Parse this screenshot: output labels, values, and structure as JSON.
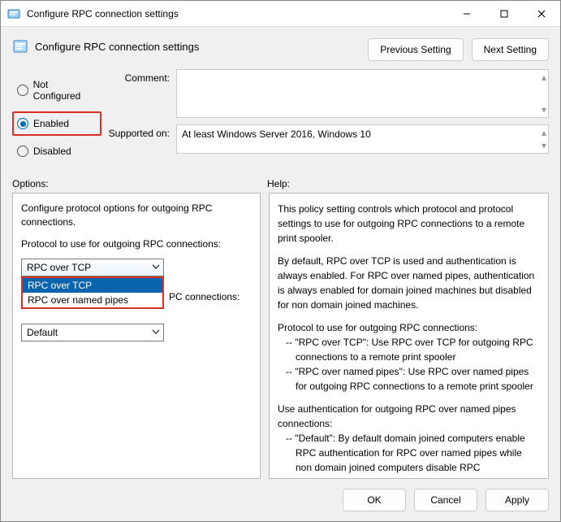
{
  "window": {
    "title": "Configure RPC connection settings"
  },
  "header": {
    "title": "Configure RPC connection settings",
    "previous": "Previous Setting",
    "next": "Next Setting"
  },
  "state": {
    "not_configured": "Not Configured",
    "enabled": "Enabled",
    "disabled": "Disabled",
    "selected": "enabled"
  },
  "meta": {
    "comment_label": "Comment:",
    "comment_value": "",
    "supported_label": "Supported on:",
    "supported_value": "At least Windows Server 2016, Windows 10"
  },
  "sections": {
    "options": "Options:",
    "help": "Help:"
  },
  "options": {
    "intro": "Configure protocol options for outgoing RPC connections.",
    "protocol_label": "Protocol to use for outgoing RPC connections:",
    "protocol_selected": "RPC over TCP",
    "protocol_items": [
      "RPC over TCP",
      "RPC over named pipes"
    ],
    "auth_label_tail": "PC connections:",
    "auth_selected": "Default"
  },
  "help": {
    "p1": "This policy setting controls which protocol and protocol settings to use for outgoing RPC connections to a remote print spooler.",
    "p2": "By default, RPC over TCP is used and authentication is always enabled. For RPC over named pipes, authentication is always enabled for domain joined machines but disabled for non domain joined machines.",
    "p3": "Protocol to use for outgoing RPC connections:",
    "p3a": "-- \"RPC over TCP\": Use RPC over TCP for outgoing RPC connections to a remote print spooler",
    "p3b": "-- \"RPC over named pipes\": Use RPC over named pipes for outgoing RPC connections to a remote print spooler",
    "p4": "Use authentication for outgoing RPC over named pipes connections:",
    "p4a": "-- \"Default\": By default domain joined computers enable RPC authentication for RPC over named pipes while non domain joined computers disable RPC authentication for RPC over named pipes"
  },
  "footer": {
    "ok": "OK",
    "cancel": "Cancel",
    "apply": "Apply"
  }
}
